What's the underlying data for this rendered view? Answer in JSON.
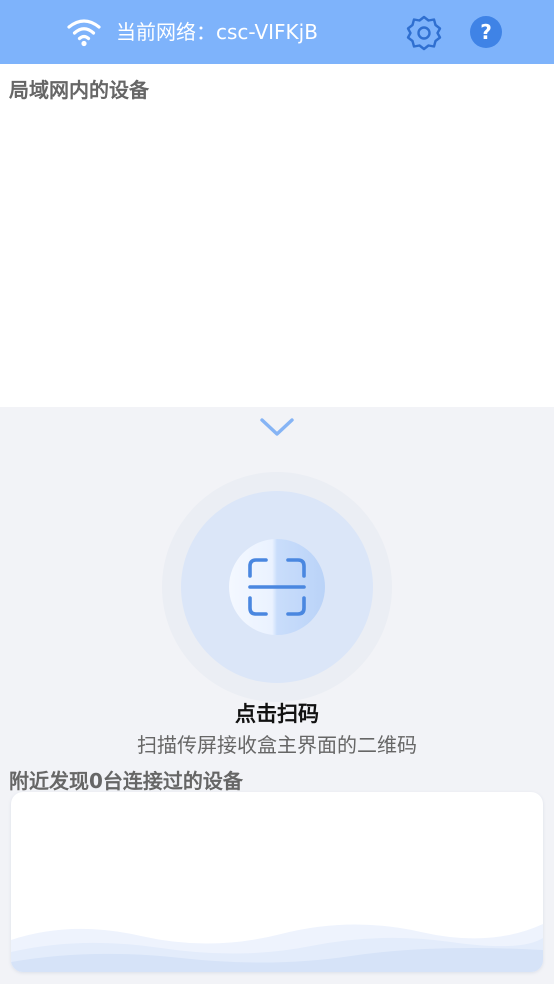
{
  "header": {
    "network_label": "当前网络：csc-VIFKjB",
    "wifi_icon": "wifi-icon",
    "settings_icon": "gear-icon",
    "help_label": "?"
  },
  "lan_section": {
    "title": "局域网内的设备"
  },
  "scan": {
    "title": "点击扫码",
    "subtitle": "扫描传屏接收盒主界面的二维码",
    "icon": "scan-icon"
  },
  "nearby_section": {
    "title": "附近发现0台连接过的设备"
  },
  "colors": {
    "header_bg": "#7eb3fb",
    "accent": "#3f83e6",
    "scan_circle": "#dbe6f8",
    "chevron": "#86b4f5"
  }
}
